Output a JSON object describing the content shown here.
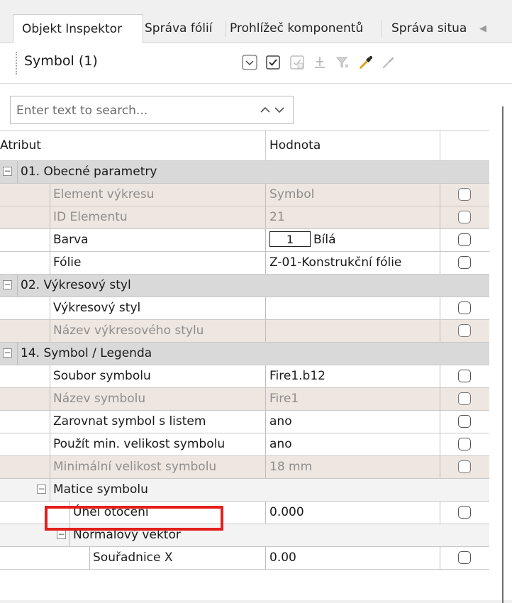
{
  "tabs": [
    {
      "label": "Objekt Inspektor",
      "active": true
    },
    {
      "label": "Správa fólií",
      "active": false
    },
    {
      "label": "Prohlížeč komponentů",
      "active": false
    },
    {
      "label": "Správa situa",
      "active": false
    }
  ],
  "toolbar": {
    "selection_label": "Symbol (1)",
    "buttons": [
      "chevron-down-icon",
      "checkbox-checked-icon",
      "checkbox-checked-disabled-icon",
      "anchor-icon",
      "filter-icon",
      "eyedropper-icon",
      "brush-icon"
    ]
  },
  "search": {
    "placeholder": "Enter text to search..."
  },
  "grid": {
    "headers": {
      "attribute": "Atribut",
      "value": "Hodnota"
    },
    "groups": {
      "general": "01. Obecné parametry",
      "drawing_style": "02. Výkresový styl",
      "symbol_legend": "14. Symbol / Legenda",
      "symbol_matrix": "Matice symbolu",
      "normal_vector": "Normálový vektor"
    },
    "rows": {
      "element": {
        "name": "Element výkresu",
        "value": "Symbol"
      },
      "element_id": {
        "name": "ID Elementu",
        "value": "21"
      },
      "color": {
        "name": "Barva",
        "index": "1",
        "value": "Bílá"
      },
      "layer": {
        "name": "Fólie",
        "value": "Z-01-Konstrukční fólie"
      },
      "style": {
        "name": "Výkresový styl",
        "value": ""
      },
      "style_name": {
        "name": "Název výkresového stylu",
        "value": ""
      },
      "symbol_file": {
        "name": "Soubor symbolu",
        "value": "Fire1.b12"
      },
      "symbol_name": {
        "name": "Název symbolu",
        "value": "Fire1"
      },
      "align_sheet": {
        "name": "Zarovnat symbol s listem",
        "value": "ano"
      },
      "use_min_size": {
        "name": "Použít min. velikost symbolu",
        "value": "ano"
      },
      "min_size": {
        "name": "Minimální velikost symbolu",
        "value": "18 mm"
      },
      "rotation": {
        "name": "Úhel otočení",
        "value": "0.000"
      },
      "coord_x": {
        "name": "Souřadnice X",
        "value": "0.00"
      }
    }
  },
  "colors": {
    "highlight": "#e41e1e",
    "group_row": "#d9d9d9",
    "readonly_row": "#eee6e0",
    "eyedropper_accent": "#e0a020"
  }
}
